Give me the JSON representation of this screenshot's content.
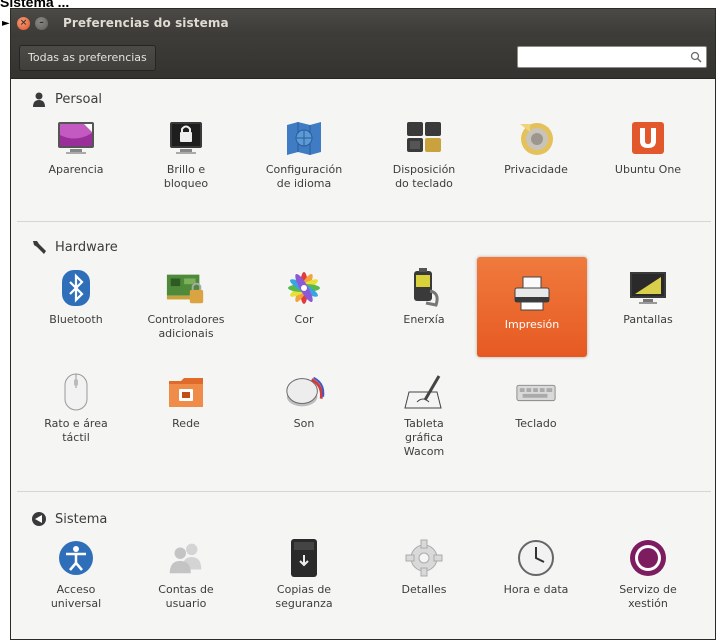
{
  "caption": "Sistema ...",
  "window": {
    "title": "Preferencias do sistema"
  },
  "toolbar": {
    "all_prefs_label": "Todas as preferencias",
    "search_placeholder": ""
  },
  "sections": {
    "personal": {
      "title": "Persoal",
      "items": [
        {
          "label": "Aparencia",
          "icon": "appearance-icon"
        },
        {
          "label": "Brillo e\nbloqueo",
          "icon": "brightness-lock-icon"
        },
        {
          "label": "Configuración\nde idioma",
          "icon": "language-icon"
        },
        {
          "label": "Disposición\ndo teclado",
          "icon": "keyboard-layout-icon"
        },
        {
          "label": "Privacidade",
          "icon": "privacy-icon"
        },
        {
          "label": "Ubuntu One",
          "icon": "ubuntu-one-icon"
        }
      ]
    },
    "hardware": {
      "title": "Hardware",
      "items": [
        {
          "label": "Bluetooth",
          "icon": "bluetooth-icon"
        },
        {
          "label": "Controladores\nadicionais",
          "icon": "drivers-icon"
        },
        {
          "label": "Cor",
          "icon": "color-icon"
        },
        {
          "label": "Enerxía",
          "icon": "power-icon"
        },
        {
          "label": "Impresión",
          "icon": "printer-icon",
          "selected": true
        },
        {
          "label": "Pantallas",
          "icon": "displays-icon"
        },
        {
          "label": "Rato e área\ntáctil",
          "icon": "mouse-icon"
        },
        {
          "label": "Rede",
          "icon": "network-icon"
        },
        {
          "label": "Son",
          "icon": "sound-icon"
        },
        {
          "label": "Tableta\ngráfica\nWacom",
          "icon": "wacom-tablet-icon"
        },
        {
          "label": "Teclado",
          "icon": "keyboard-icon"
        }
      ]
    },
    "system": {
      "title": "Sistema",
      "items": [
        {
          "label": "Acceso\nuniversal",
          "icon": "universal-access-icon"
        },
        {
          "label": "Contas de\nusuario",
          "icon": "user-accounts-icon"
        },
        {
          "label": "Copias de\nseguranza",
          "icon": "backup-icon"
        },
        {
          "label": "Detalles",
          "icon": "details-icon"
        },
        {
          "label": "Hora e data",
          "icon": "time-date-icon"
        },
        {
          "label": "Servizo de\nxestión",
          "icon": "management-service-icon"
        }
      ]
    }
  },
  "colors": {
    "selected_bg": "#e9602a",
    "titlebar_bg": "#3c3b37"
  }
}
